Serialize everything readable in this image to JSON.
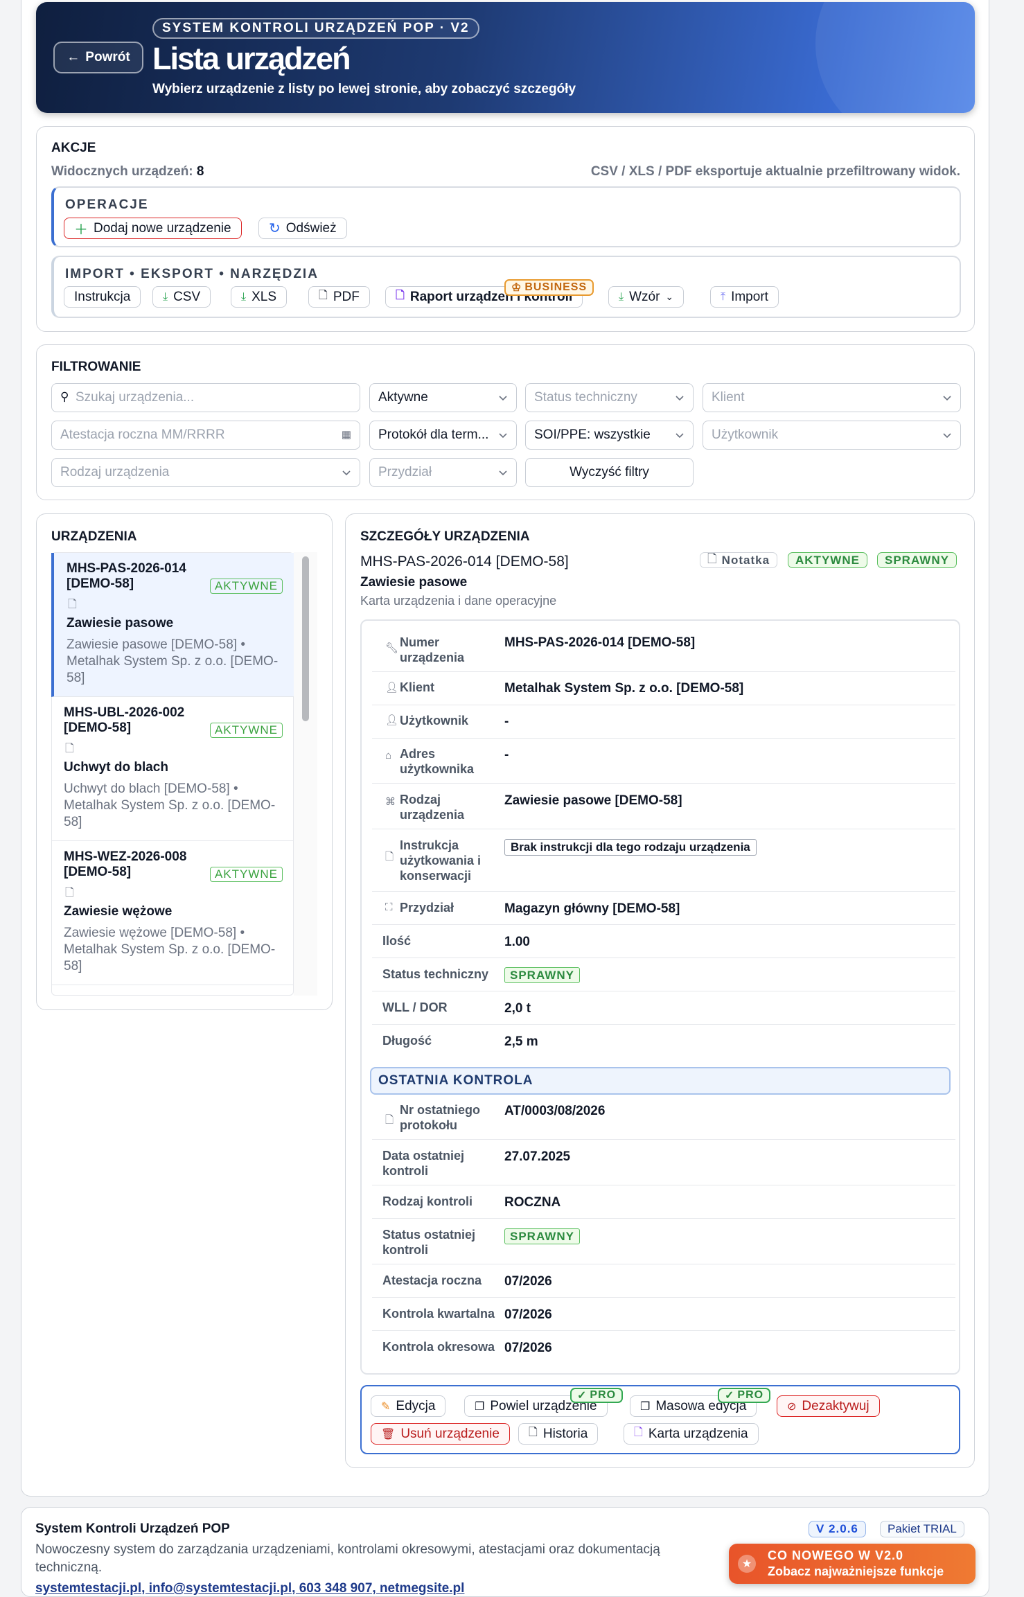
{
  "header": {
    "back_label": "Powrót",
    "pill": "SYSTEM KONTROLI URZĄDZEŃ POP · V2",
    "title": "Lista urządzeń",
    "subtitle": "Wybierz urządzenie z listy po lewej stronie, aby zobaczyć szczegóły"
  },
  "actions": {
    "title": "AKCJE",
    "visible_label": "Widocznych urządzeń:",
    "visible_count": "8",
    "export_note": "CSV / XLS / PDF eksportuje aktualnie przefiltrowany widok.",
    "operations": {
      "title": "OPERACJE",
      "add": "Dodaj nowe urządzenie",
      "refresh": "Odśwież"
    },
    "tools": {
      "title": "IMPORT • EKSPORT • NARZĘDZIA",
      "instruction": "Instrukcja",
      "csv": "CSV",
      "xls": "XLS",
      "pdf": "PDF",
      "report": "Raport urządzeń i kontroli",
      "business_badge": "BUSINESS",
      "template": "Wzór",
      "import": "Import"
    }
  },
  "filters": {
    "title": "FILTROWANIE",
    "search_placeholder": "Szukaj urządzenia...",
    "status": "Aktywne",
    "tech_status_placeholder": "Status techniczny",
    "client_placeholder": "Klient",
    "attest_placeholder": "Atestacja roczna MM/RRRR",
    "protocol": "Protokół dla term...",
    "soi": "SOI/PPE: wszystkie",
    "user_placeholder": "Użytkownik",
    "type_placeholder": "Rodzaj urządzenia",
    "assign_placeholder": "Przydział",
    "clear": "Wyczyść filtry"
  },
  "devices": {
    "title": "URZĄDZENIA",
    "items": [
      {
        "code": "MHS-PAS-2026-014 [DEMO-58]",
        "badge": "AKTYWNE",
        "name": "Zawiesie pasowe",
        "desc": "Zawiesie pasowe [DEMO-58] • Metalhak System Sp. z o.o. [DEMO-58]"
      },
      {
        "code": "MHS-UBL-2026-002 [DEMO-58]",
        "badge": "AKTYWNE",
        "name": "Uchwyt do blach",
        "desc": "Uchwyt do blach [DEMO-58] • Metalhak System Sp. z o.o. [DEMO-58]"
      },
      {
        "code": "MHS-WEZ-2026-008 [DEMO-58]",
        "badge": "AKTYWNE",
        "name": "Zawiesie wężowe",
        "desc": "Zawiesie wężowe [DEMO-58] • Metalhak System Sp. z o.o. [DEMO-58]"
      }
    ]
  },
  "details": {
    "title": "SZCZEGÓŁY URZĄDZENIA",
    "code": "MHS-PAS-2026-014 [DEMO-58]",
    "note_badge": "Notatka",
    "badge_active": "AKTYWNE",
    "badge_ok": "SPRAWNY",
    "name": "Zawiesie pasowe",
    "subtitle": "Karta urządzenia i dane operacyjne",
    "rows": {
      "number_label": "Numer urządzenia",
      "number": "MHS-PAS-2026-014 [DEMO-58]",
      "client_label": "Klient",
      "client": "Metalhak System Sp. z o.o. [DEMO-58]",
      "user_label": "Użytkownik",
      "user": "-",
      "address_label": "Adres użytkownika",
      "address": "-",
      "type_label": "Rodzaj urządzenia",
      "type": "Zawiesie pasowe [DEMO-58]",
      "manual_label": "Instrukcja użytkowania i konserwacji",
      "manual": "Brak instrukcji dla tego rodzaju urządzenia",
      "assign_label": "Przydział",
      "assign": "Magazyn główny [DEMO-58]",
      "qty_label": "Ilość",
      "qty": "1.00",
      "tech_label": "Status techniczny",
      "tech": "SPRAWNY",
      "wll_label": "WLL / DOR",
      "wll": "2,0 t",
      "length_label": "Długość",
      "length": "2,5 m"
    },
    "last_control": {
      "title": "OSTATNIA KONTROLA",
      "protocol_label": "Nr ostatniego protokołu",
      "protocol": "AT/0003/08/2026",
      "date_label": "Data ostatniej kontroli",
      "date": "27.07.2025",
      "kind_label": "Rodzaj kontroli",
      "kind": "ROCZNA",
      "status_label": "Status ostatniej kontroli",
      "status": "SPRAWNY",
      "annual_label": "Atestacja roczna",
      "annual": "07/2026",
      "quarter_label": "Kontrola kwartalna",
      "quarter": "07/2026",
      "periodic_label": "Kontrola okresowa",
      "periodic": "07/2026"
    },
    "buttons": {
      "edit": "Edycja",
      "duplicate": "Powiel urządzenie",
      "pro": "PRO",
      "bulk": "Masowa edycja",
      "deactivate": "Dezaktywuj",
      "delete": "Usuń urządzenie",
      "history": "Historia",
      "card": "Karta urządzenia"
    }
  },
  "footer": {
    "title": "System Kontroli Urządzeń POP",
    "desc": "Nowoczesny system do zarządzania urządzeniami, kontrolami okresowymi, atestacjami oraz dokumentacją techniczną.",
    "version": "V 2.0.6",
    "plan": "Pakiet TRIAL",
    "contact": "systemtestacji.pl, info@systemtestacji.pl, 603 348 907, netmegsite.pl",
    "cta_title": "CO NOWEGO W V2.0",
    "cta_sub": "Zobacz najważniejsze funkcje"
  },
  "colors": {
    "accent": "#3b6fd1",
    "success": "#2b8a3e",
    "danger": "#dc2626",
    "business": "#e89a2f"
  }
}
